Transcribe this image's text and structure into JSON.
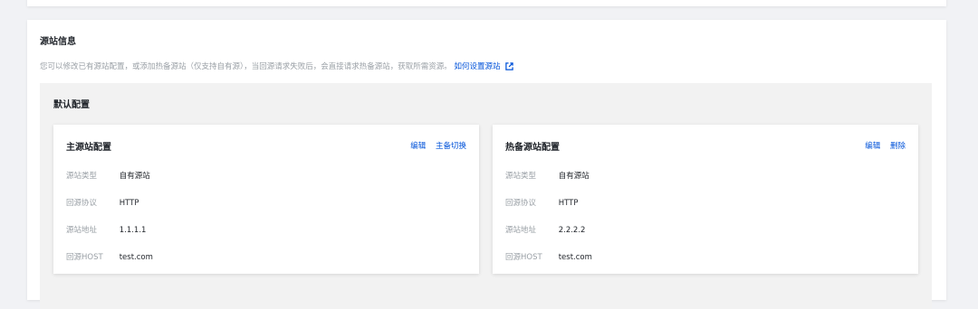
{
  "section": {
    "title": "源站信息",
    "description": "您可以修改已有源站配置，或添加热备源站（仅支持自有源），当回源请求失败后，会直接请求热备源站，获取所需资源。",
    "link_text": "如何设置源站"
  },
  "default_config": {
    "title": "默认配置"
  },
  "primary": {
    "title": "主源站配置",
    "actions": [
      "编辑",
      "主备切换"
    ],
    "rows": [
      {
        "label": "源站类型",
        "value": "自有源站"
      },
      {
        "label": "回源协议",
        "value": "HTTP"
      },
      {
        "label": "源站地址",
        "value": "1.1.1.1"
      },
      {
        "label": "回源HOST",
        "value": "test.com"
      }
    ]
  },
  "backup": {
    "title": "热备源站配置",
    "actions": [
      "编辑",
      "删除"
    ],
    "rows": [
      {
        "label": "源站类型",
        "value": "自有源站"
      },
      {
        "label": "回源协议",
        "value": "HTTP"
      },
      {
        "label": "源站地址",
        "value": "2.2.2.2"
      },
      {
        "label": "回源HOST",
        "value": "test.com"
      }
    ]
  },
  "icons": {
    "external_link": "external-link-icon"
  },
  "colors": {
    "link": "#0052d9",
    "muted": "#9aa0a6",
    "panel_bg": "#f2f2f2"
  }
}
